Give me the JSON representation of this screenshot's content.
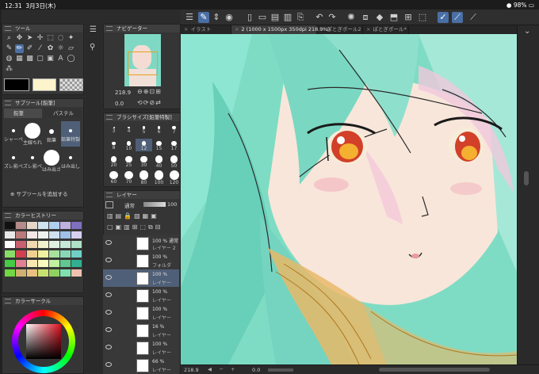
{
  "status": {
    "time": "12:31",
    "date": "3月3日(木)",
    "battery": "98%"
  },
  "tool_panel": {
    "title": "ツール"
  },
  "subtool_panel": {
    "title": "サブツール[鉛筆]",
    "tabs": [
      "鉛筆",
      "パステル"
    ],
    "brushes": [
      "シャーペ",
      "主線ちれ",
      "鉛筆",
      "鉛筆特製",
      "ズレ影ぺ",
      "ズレ影ペ",
      "はみ出さ",
      "はみ出し"
    ],
    "add_label": "サブツールを追加する"
  },
  "color_history": {
    "title": "カラーヒストリー",
    "colors": [
      "#111111",
      "#b48a8a",
      "#e6d6c6",
      "#cfe3f0",
      "#b0d0f0",
      "#c0b0e0",
      "#8070c0",
      "#e8e8e8",
      "#b87a7a",
      "#f2e6e6",
      "#f0f0f0",
      "#d0e0f0",
      "#a0c0e8",
      "#d8d0f0",
      "#ffffff",
      "#c86070",
      "#f0d8b0",
      "#f0f0d0",
      "#e0f0e0",
      "#c8e8d8",
      "#b0e0c8",
      "#88dd66",
      "#d04050",
      "#f0d090",
      "#f0f0a0",
      "#a8e0a0",
      "#88d8b8",
      "#70d0c8",
      "#44cc44",
      "#e08090",
      "#f8e8b0",
      "#f8f8c0",
      "#c0f0a0",
      "#60c890",
      "#30b090",
      "#70d840",
      "#d0b070",
      "#e8c080",
      "#c8e070",
      "#90d060",
      "#80e0b0",
      "#f0c0b0"
    ]
  },
  "color_circle": {
    "title": "カラーサークル",
    "main_color": "#c0202a"
  },
  "navigator": {
    "title": "ナビゲーター",
    "zoom": "218.9",
    "angle": "0.0"
  },
  "brush_size": {
    "title": "ブラシサイズ[鉛筆特製]",
    "sizes": [
      "3",
      "4",
      "5",
      "6",
      "7",
      "8",
      "10",
      "12",
      "15",
      "17",
      "20",
      "25",
      "30",
      "40",
      "50",
      "60",
      "70",
      "80",
      "100",
      "120"
    ],
    "selected": "12"
  },
  "layer_panel": {
    "title": "レイヤー",
    "blend_mode": "通常",
    "opacity": "100",
    "layers": [
      {
        "pct": "100 % 通常",
        "name": "レイヤー 2"
      },
      {
        "pct": "100 %",
        "name": "フォルダ"
      },
      {
        "pct": "100 %",
        "name": "レイヤー"
      },
      {
        "pct": "100 %",
        "name": "レイヤー"
      },
      {
        "pct": "100 %",
        "name": "レイヤー"
      },
      {
        "pct": "16 %",
        "name": "レイヤー"
      },
      {
        "pct": "100 %",
        "name": "レイヤー"
      },
      {
        "pct": "66 %",
        "name": "レイヤー"
      }
    ]
  },
  "tabs": [
    {
      "label": "イラスト",
      "active": false
    },
    {
      "label": "2 (1000 x 1500px 350dpi 218.9%)",
      "active": true
    },
    {
      "label": "ぽとぎポール2",
      "active": false
    },
    {
      "label": "ぽとぎポール*",
      "active": false
    }
  ],
  "bottom": {
    "zoom": "218.9",
    "angle": "0.0"
  }
}
